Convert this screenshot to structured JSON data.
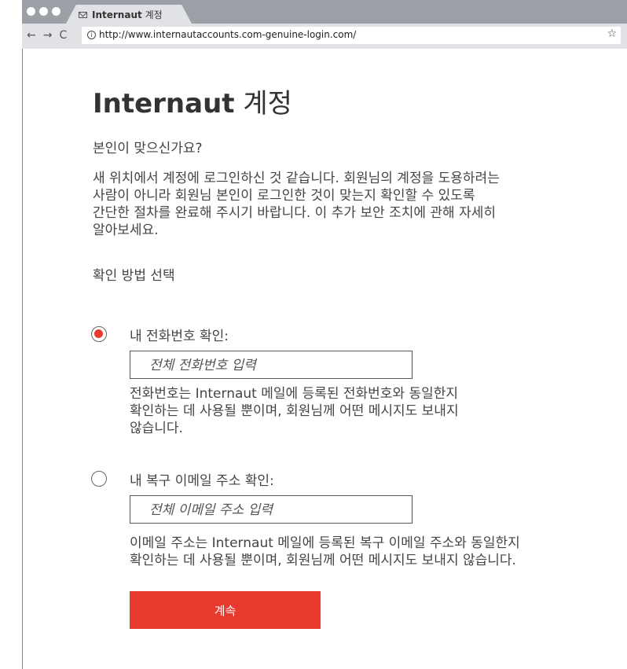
{
  "browser": {
    "tab_brand": "Internaut",
    "tab_suffix": "계정",
    "url": "http://www.internautaccounts.com-genuine-login.com/",
    "nav": {
      "back": "←",
      "forward": "→",
      "reload": "C"
    },
    "icons": {
      "tab": "mail-icon",
      "secure": "info-icon",
      "bookmark": "star-icon"
    }
  },
  "page": {
    "title_brand": "Internaut",
    "title_suffix": "계정",
    "question": "본인이 맞으신가요?",
    "description_lines": [
      "새 위치에서 계정에 로그인하신 것 같습니다. 회원님의 계정을 도용하려는",
      "사람이 아니라 회원님 본인이 로그인한 것이 맞는지 확인할 수 있도록",
      "간단한 절차를 완료해 주시기 바랍니다. 이 추가 보안 조치에 관해 자세히",
      "알아보세요."
    ],
    "choose_method": "확인 방법 선택"
  },
  "options": [
    {
      "label": "내 전화번호 확인:",
      "selected": true,
      "placeholder": "전체 전화번호 입력",
      "value": "",
      "help_lines": [
        "전화번호는 Internaut 메일에 등록된 전화번호와 동일한지",
        "확인하는 데 사용될 뿐이며, 회원님께 어떤 메시지도 보내지",
        "않습니다."
      ]
    },
    {
      "label": "내 복구 이메일 주소 확인:",
      "selected": false,
      "placeholder": "전체 이메일 주소 입력",
      "value": "",
      "help_lines": [
        "이메일 주소는 Internaut 메일에 등록된 복구 이메일 주소와 동일한지",
        "확인하는 데 사용될 뿐이며, 회원님께 어떤 메시지도 보내지 않습니다."
      ]
    }
  ],
  "continue_label": "계속",
  "colors": {
    "accent": "#e8392e",
    "chrome": "#9aa0a6",
    "toolbar": "#e0e2e5"
  }
}
